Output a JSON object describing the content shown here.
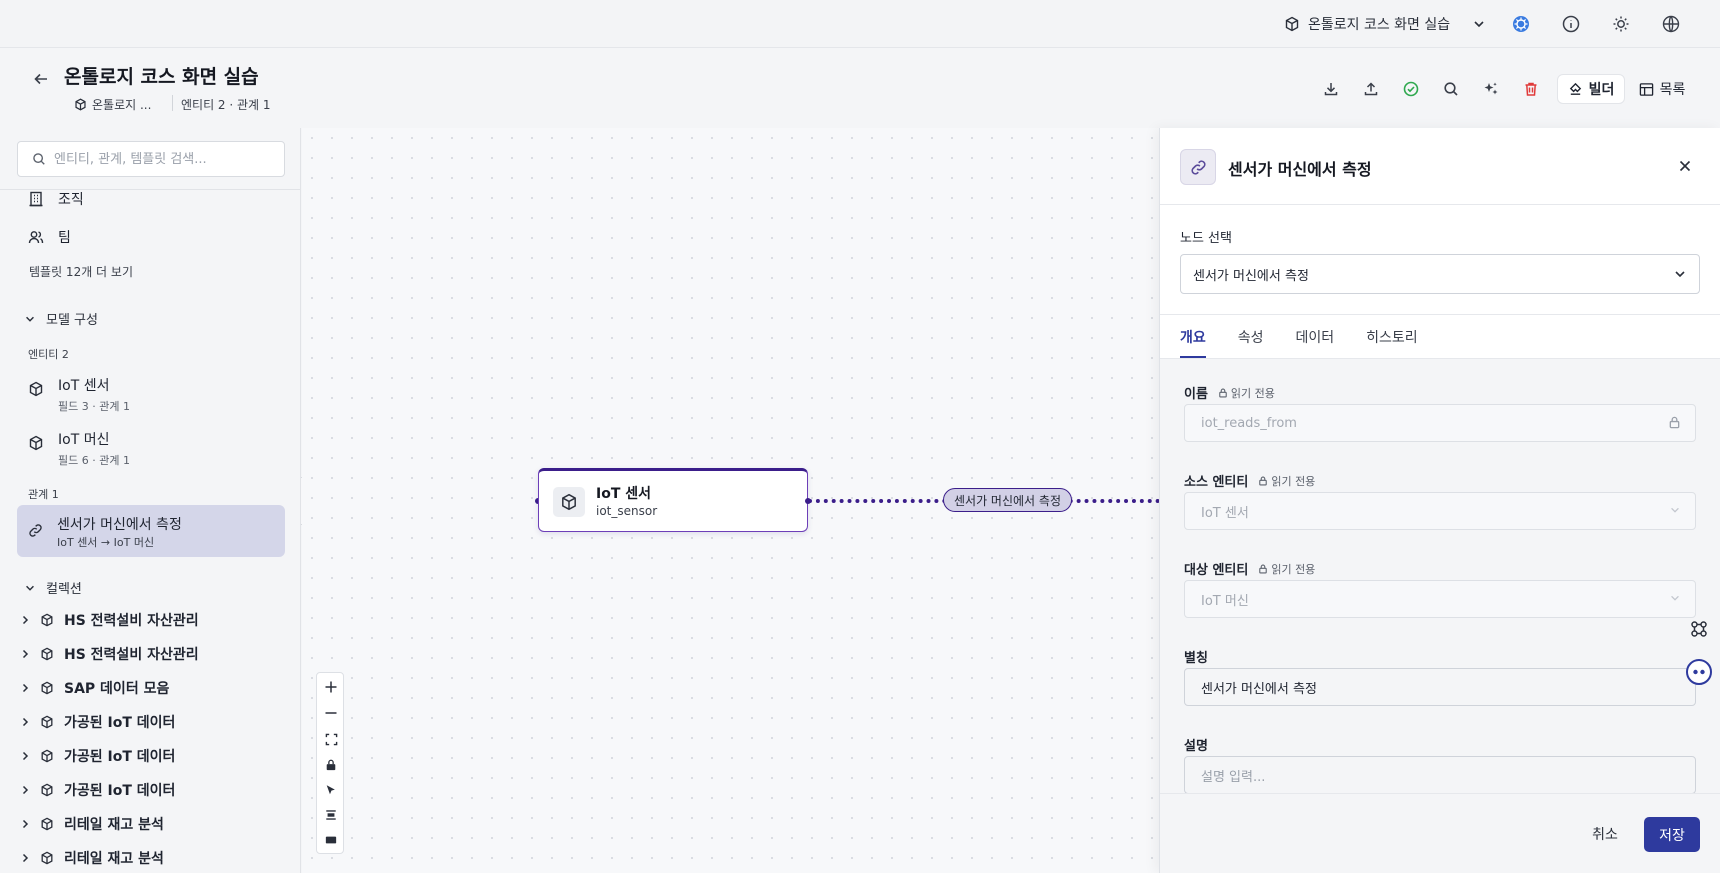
{
  "topbar": {
    "project_name": "온톨로지 코스 화면 실습"
  },
  "header": {
    "title": "온톨로지 코스 화면 실습",
    "breadcrumb_project": "온톨로지 ...",
    "breadcrumb_stats": "엔티티 2 · 관계 1",
    "builder_label": "빌더",
    "list_label": "목록"
  },
  "sidebar": {
    "search_placeholder": "엔티티, 관계, 템플릿 검색...",
    "templates": [
      {
        "label": "조직",
        "icon": "building-icon"
      },
      {
        "label": "팀",
        "icon": "users-icon"
      }
    ],
    "more_templates": "템플릿 12개 더 보기",
    "model_section": "모델 구성",
    "entity_count_label": "엔티티 2",
    "entities": [
      {
        "name": "IoT 센서",
        "meta": "필드 3 · 관계 1"
      },
      {
        "name": "IoT 머신",
        "meta": "필드 6 · 관계 1"
      }
    ],
    "relation_count_label": "관계 1",
    "relation": {
      "name": "센서가 머신에서 측정",
      "meta": "IoT 센서 → IoT 머신"
    },
    "collection_section": "컬렉션",
    "collections": [
      "HS 전력설비 자산관리",
      "HS 전력설비 자산관리",
      "SAP 데이터 모음",
      "가공된 IoT 데이터",
      "가공된 IoT 데이터",
      "가공된 IoT 데이터",
      "리테일 재고 분석",
      "리테일 재고 분석"
    ]
  },
  "canvas": {
    "node": {
      "title": "IoT 센서",
      "subtitle": "iot_sensor"
    },
    "edge_label": "센서가 머신에서 측정"
  },
  "panel": {
    "title": "센서가 머신에서 측정",
    "node_select_label": "노드 선택",
    "node_select_value": "센서가 머신에서 측정",
    "tabs": [
      "개요",
      "속성",
      "데이터",
      "히스토리"
    ],
    "active_tab": "개요",
    "readonly_text": "읽기 전용",
    "fields": {
      "name_label": "이름",
      "name_value": "iot_reads_from",
      "source_label": "소스 엔티티",
      "source_value": "IoT 센서",
      "target_label": "대상 엔티티",
      "target_value": "IoT 머신",
      "alias_label": "별칭",
      "alias_value": "센서가 머신에서 측정",
      "desc_label": "설명",
      "desc_placeholder": "설명 입력..."
    },
    "cancel_label": "취소",
    "save_label": "저장"
  },
  "colors": {
    "accent": "#2e3a9e",
    "edge": "#3b1e8a",
    "selected_bg": "#d4d6e9",
    "delete": "#e03a3a",
    "check": "#2fa84f"
  }
}
